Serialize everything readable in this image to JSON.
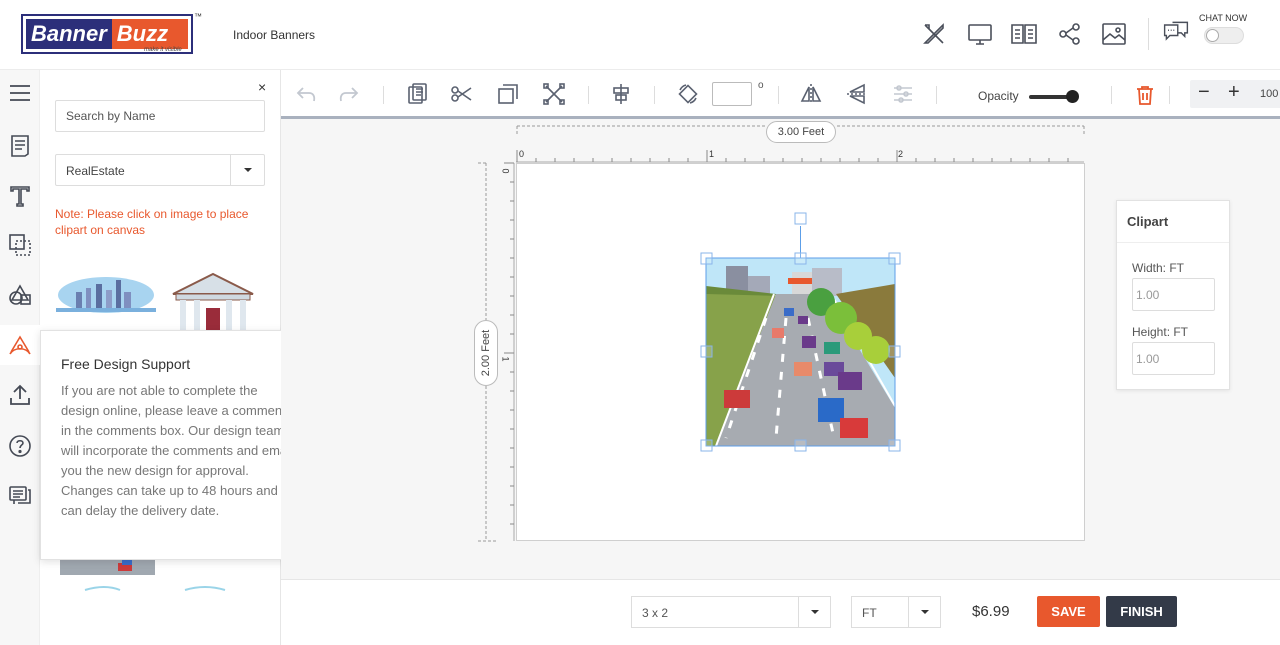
{
  "header": {
    "logo_part1": "Banner",
    "logo_part2": "Buzz",
    "logo_tm": "™",
    "logo_tagline": "make it visible",
    "product_name": "Indoor Banners",
    "chat_label": "CHAT NOW"
  },
  "panel": {
    "close": "×",
    "search_placeholder": "Search by Name",
    "category": "RealEstate",
    "note": "Note: Please click on image to place clipart on canvas"
  },
  "popup": {
    "title": "Free Design Support",
    "close": "×",
    "body": "If you are not able to complete the design online, please leave a comments in the comments box. Our design team will incorporate the comments and email you the new design for approval. Changes can take up to 48 hours and can delay the delivery date."
  },
  "toolbar": {
    "degree_symbol": "o",
    "opacity_label": "Opacity",
    "zoom_minus": "−",
    "zoom_plus": "+",
    "zoom_value": "100"
  },
  "canvas": {
    "width_label": "3.00 Feet",
    "height_label": "2.00 Feet",
    "ruler_top": [
      "0",
      "1",
      "2"
    ],
    "ruler_left": [
      "0",
      "1"
    ]
  },
  "clipart_props": {
    "title": "Clipart",
    "width_label": "Width: FT",
    "width_value": "1.00",
    "height_label": "Height: FT",
    "height_value": "1.00"
  },
  "footer": {
    "size": "3 x 2",
    "unit": "FT",
    "price": "$6.99",
    "save_label": "SAVE",
    "finish_label": "FINISH"
  },
  "colors": {
    "brand_blue": "#2c2f7a",
    "brand_orange": "#e8582d",
    "dark_button": "#333a48"
  }
}
